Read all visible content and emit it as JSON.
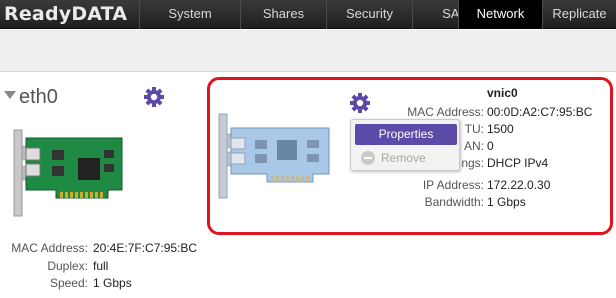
{
  "brand": {
    "logo_text": "ReadyDATA"
  },
  "nav": {
    "tabs": [
      {
        "label": "System"
      },
      {
        "label": "Shares"
      },
      {
        "label": "Security"
      },
      {
        "label": "SAN"
      },
      {
        "label": "Network",
        "active": true
      },
      {
        "label": "Replicate"
      }
    ]
  },
  "interfaces": {
    "eth0": {
      "name": "eth0",
      "mac_label": "MAC Address:",
      "mac_value": "20:4E:7F:C7:95:BC",
      "duplex_label": "Duplex:",
      "duplex_value": "full",
      "speed_label": "Speed:",
      "speed_value": "1 Gbps"
    },
    "vnic0": {
      "name": "vnic0",
      "mac_label": "MAC Address:",
      "mac_value": "00:0D:A2:C7:95:BC",
      "mtu_label_partial": "TU:",
      "mtu_value": "1500",
      "vlan_label_partial": "AN:",
      "vlan_value": "0",
      "settings_label_partial": "ngs:",
      "settings_value": "DHCP IPv4",
      "ip_label": "IP Address:",
      "ip_value": "172.22.0.30",
      "bandwidth_label": "Bandwidth:",
      "bandwidth_value": "1 Gbps"
    }
  },
  "context_menu": {
    "properties_label": "Properties",
    "remove_label": "Remove"
  },
  "colors": {
    "accent": "#5b4aa8",
    "highlight_border": "#e0141e",
    "topbar": "#2a2a2a"
  },
  "icons": {
    "settings": "gear-icon",
    "collapse": "triangle-down-icon",
    "remove": "minus-circle-icon"
  }
}
